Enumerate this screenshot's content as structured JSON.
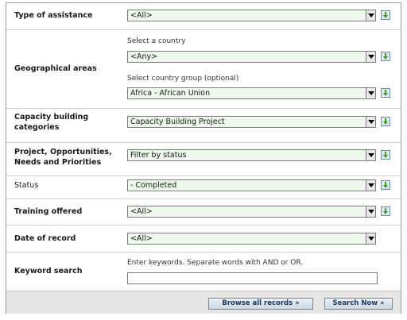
{
  "fields": {
    "assistance": {
      "label": "Type of assistance",
      "value": "<All>"
    },
    "geo": {
      "label": "Geographical areas",
      "country_hint": "Select a country",
      "country_value": "<Any>",
      "group_hint": "Select country group (optional)",
      "group_value": "Africa - African Union"
    },
    "capacity": {
      "label_line1": "Capacity building",
      "label_line2": "categories",
      "value": "Capacity Building Project"
    },
    "project": {
      "label_line1": "Project, Opportunities,",
      "label_line2": "Needs and Priorities",
      "value": "Filter by status"
    },
    "status": {
      "label": "Status",
      "value": "- Completed"
    },
    "training": {
      "label": "Training offered",
      "value": "<All>"
    },
    "date": {
      "label": "Date of record",
      "value": "<All>"
    },
    "keyword": {
      "label": "Keyword search",
      "hint": "Enter keywords. Separate words with AND or OR.",
      "value": ""
    }
  },
  "buttons": {
    "browse": "Browse all records »",
    "search": "Search Now »"
  },
  "icons": {
    "add": "green-down-arrow-icon"
  },
  "colors": {
    "select_bg": "#eef8ec",
    "button_text": "#17375e",
    "footer_bg": "#e6e6e6"
  }
}
